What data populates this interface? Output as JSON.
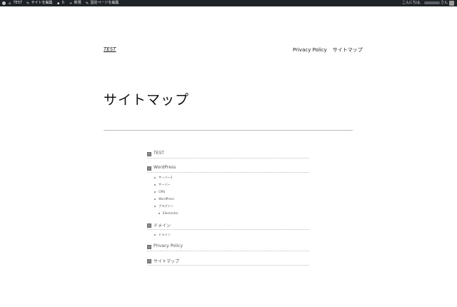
{
  "adminbar": {
    "site_name": "TEST",
    "edit_site": "サイトを編集",
    "comments_count": "0",
    "new_label": "新規",
    "edit_page": "固定ページを編集",
    "greeting_prefix": "こんにちは、",
    "greeting_suffix": "さん"
  },
  "header": {
    "site_title": "TEST",
    "nav": [
      "Privacy Policy",
      "サイトマップ"
    ]
  },
  "page": {
    "title": "サイトマップ"
  },
  "sitemap": {
    "sections": [
      {
        "label": "TEST"
      },
      {
        "label": "WordPress"
      },
      {
        "label": "ドメイン"
      },
      {
        "label": "Privacy Policy"
      },
      {
        "label": "サイトマップ"
      }
    ],
    "wordpress_children": [
      "サーバー2",
      "サーバー",
      "CMS",
      "WordPress",
      "プラグイン"
    ],
    "plugin_children": [
      "Elementor"
    ],
    "domain_children": [
      "ドメイン"
    ]
  }
}
